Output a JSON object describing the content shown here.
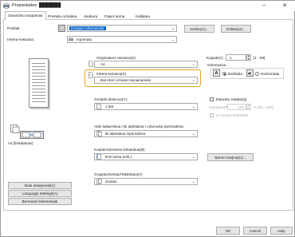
{
  "window": {
    "title": "Propiedades: ███████",
    "minimize": "─",
    "close": "✕"
  },
  "tabs": [
    {
      "label": "Oinarrizko ezarpenak",
      "active": true
    },
    {
      "label": "Prestatu orrialdea"
    },
    {
      "label": "Akabera"
    },
    {
      "label": "Paper-iturria"
    },
    {
      "label": "Kalitatea"
    }
  ],
  "profile": {
    "label": "Profilak:",
    "value": "Ezarpen lehenetsiak",
    "add_button": "Gehitu(1)...",
    "edit_button": "Editatu(2)..."
  },
  "output_method": {
    "label": "Irteera-metodoa:",
    "value": "Inprimatu"
  },
  "preview_caption": "A4 [Eskalatuta]",
  "original_size": {
    "label": "Originalaren tamaina(S):",
    "value": "A4"
  },
  "output_size": {
    "label": "Irteera-tamaina(Z):",
    "value": "Bat etorri orriaren tamainarekin"
  },
  "copies": {
    "label": "Kopiak(C):",
    "value": "1",
    "range": "[1 - 99]"
  },
  "orientation": {
    "label": "Orientazioa",
    "portrait": "Bertikala",
    "landscape": "Horizontala"
  },
  "page_layout": {
    "label": "Orrialde-diseinua(Y):",
    "value": "1 bat"
  },
  "manual_scaling": {
    "label": "Eskuzko eskala(Q)",
    "scaling_label": "Eskalatu(R):",
    "scaling_value": "100",
    "scaling_range": "% [25 - 200]",
    "watermark_label": "Ur-marka erabili(W)"
  },
  "duplex": {
    "label": "Alde bakarrekoa / Bi aldetakoa / Liburuxka-inprimaketa:",
    "value": "Bi aldetakoa inprimatzea"
  },
  "binding": {
    "label": "Koadernatzearen kokalekua(B):",
    "value": "Ertz luzea (ezk.)",
    "margin_button": "Barne-marjina(U)..."
  },
  "staple": {
    "label": "Grapatu/Sortatu/Taldekatu(H):",
    "value": "Sortatu"
  },
  "left_buttons": {
    "view_settings": "Ikusi ezarpenak(V)",
    "language": "Language Settings(A)",
    "restore": "Berrezarri lehenetsiak"
  },
  "footer": {
    "ok": "OK",
    "cancel": "Cancel",
    "help": "Help"
  },
  "colors": {
    "highlight": "#e8a317",
    "selection": "#0a64c8"
  }
}
